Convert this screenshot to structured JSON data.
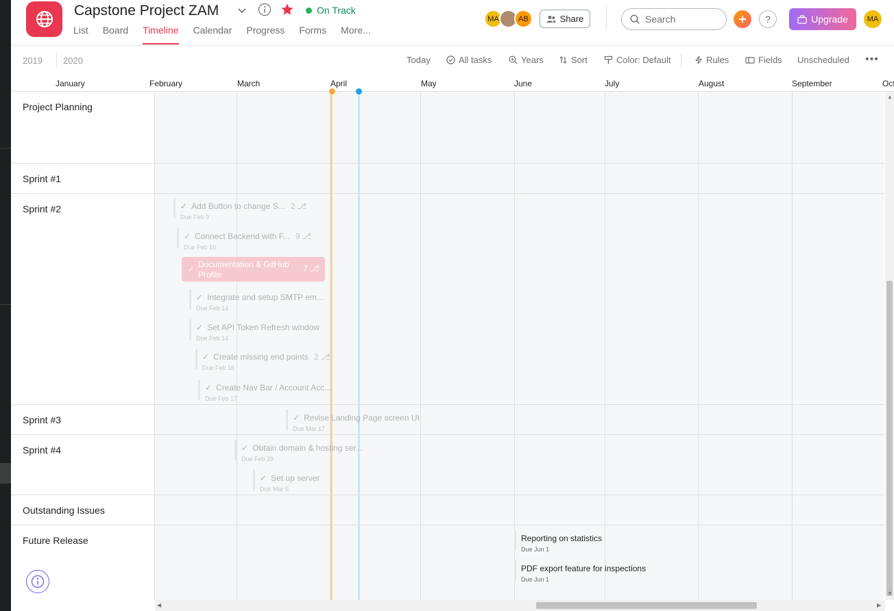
{
  "header": {
    "project_title": "Capstone Project ZAM",
    "status": "On Track",
    "tabs": [
      "List",
      "Board",
      "Timeline",
      "Calendar",
      "Progress",
      "Forms",
      "More..."
    ],
    "active_tab": "Timeline",
    "avatars": [
      {
        "initials": "MA",
        "color": "#f1bd0c"
      },
      {
        "initials": "",
        "color": "#b08a6e"
      },
      {
        "initials": "AB",
        "color": "#fd9a00"
      }
    ],
    "share_label": "Share",
    "search_placeholder": "Search",
    "help_label": "?",
    "upgrade_label": "Upgrade",
    "user_initials": "MA"
  },
  "toolbar": {
    "years": [
      "2019",
      "2020"
    ],
    "today": "Today",
    "all_tasks": "All tasks",
    "years_zoom": "Years",
    "sort": "Sort",
    "color": "Color: Default",
    "rules": "Rules",
    "fields": "Fields",
    "unscheduled": "Unscheduled"
  },
  "months": [
    "January",
    "February",
    "March",
    "April",
    "May",
    "June",
    "July",
    "August",
    "September",
    "Oct"
  ],
  "sections": [
    {
      "name": "Project Planning"
    },
    {
      "name": "Sprint #1"
    },
    {
      "name": "Sprint #2"
    },
    {
      "name": "Sprint #3"
    },
    {
      "name": "Sprint #4"
    },
    {
      "name": "Outstanding Issues"
    },
    {
      "name": "Future Release"
    }
  ],
  "tasks": [
    {
      "name": "Add Button to change S...",
      "due": "Due Feb 9",
      "subtasks": "2"
    },
    {
      "name": "Connect Backend with F...",
      "due": "Due Feb 10",
      "subtasks": "9"
    },
    {
      "name": "Documentation & GitHub Profile",
      "due": "",
      "subtasks": "7"
    },
    {
      "name": "Integrate and setup SMTP em...",
      "due": "Due Feb 14",
      "subtasks": ""
    },
    {
      "name": "Set API Token Refresh window",
      "due": "Due Feb 14",
      "subtasks": ""
    },
    {
      "name": "Create missing end points",
      "due": "Due Feb 16",
      "subtasks": "2"
    },
    {
      "name": "Create Nav Bar / Account Acc...",
      "due": "Due Feb 17",
      "subtasks": ""
    },
    {
      "name": "Revise Landing Page screen UI",
      "due": "Due Mar 17",
      "subtasks": ""
    },
    {
      "name": "Obtain domain & hosting ser...",
      "due": "Due Feb 29",
      "subtasks": ""
    },
    {
      "name": "Set up server",
      "due": "Due Mar 6",
      "subtasks": ""
    },
    {
      "name": "Reporting on statistics",
      "due": "Due Jun 1",
      "subtasks": ""
    },
    {
      "name": "PDF export feature for inspections",
      "due": "Due Jun 1",
      "subtasks": ""
    }
  ],
  "colors": {
    "accent": "#e8384f",
    "status_green": "#22b455",
    "today_marker": "#f2a93b",
    "current_marker": "#1aa1e8",
    "task_highlight": "#f6c9d0"
  }
}
